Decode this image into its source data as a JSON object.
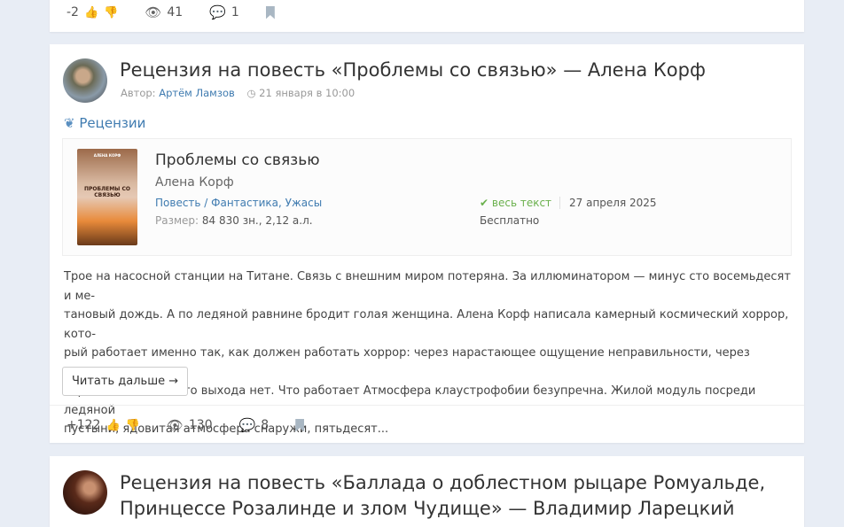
{
  "card1": {
    "rating": "-2",
    "views": "41",
    "comments": "1"
  },
  "card2": {
    "title": "Рецензия на повесть «Проблемы со связью» — Алена Корф",
    "author_label": "Автор:",
    "author": "Артём Ламзов",
    "date": "21 января в 10:00",
    "category": "Рецензии",
    "book": {
      "cover_author": "АЛЕНА КОРФ",
      "cover_title": "ПРОБЛЕМЫ СО СВЯЗЬЮ",
      "title": "Проблемы со связью",
      "author": "Алена Корф",
      "type": "Повесть",
      "genres": "Фантастика, Ужасы",
      "size_label": "Размер:",
      "size": "84 830 зн., 2,12 а.л.",
      "status": "весь текст",
      "date": "27 апреля 2025",
      "price": "Бесплатно"
    },
    "text": [
      "Трое на насосной станции на Титане. Связь с внешним миром потеряна. За иллюминатором — минус сто восемьдесят и ме-",
      "тановый дождь. А по ледяной равнине бродит голая женщина. Алена Корф написала камерный космический хоррор, кото-",
      "рый работает именно так, как должен работать хоррор: через нарастающее ощущение неправильности, через изоляцию,",
      "через понимание, что выхода нет. Что работает Атмосфера клаустрофобии безупречна. Жилой модуль посреди ледяной",
      "пустыни, ядовитая атмосфера снаружи, пятьдесят..."
    ],
    "read_more": "Читать дальше →",
    "rating": "+122",
    "views": "130",
    "comments": "8"
  },
  "card3": {
    "title_line1": "Рецензия на повесть «Баллада о доблестном рыцаре Ромуальде,",
    "title_line2": "Принцессе Розалинде и злом Чудище» — Владимир Ларецкий"
  }
}
